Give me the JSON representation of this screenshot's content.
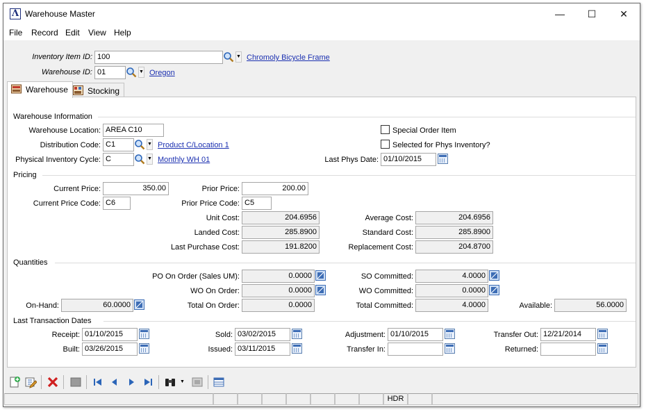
{
  "window": {
    "title": "Warehouse Master",
    "minimize": "—",
    "maximize": "☐",
    "close": "✕"
  },
  "menu": [
    "File",
    "Record",
    "Edit",
    "View",
    "Help"
  ],
  "header": {
    "item_label": "Inventory Item ID:",
    "item_value": "100",
    "item_link": "Chromoly Bicycle Frame",
    "warehouse_label": "Warehouse ID:",
    "warehouse_value": "01",
    "warehouse_link": "Oregon"
  },
  "tabs": [
    {
      "label": "Warehouse",
      "active": true
    },
    {
      "label": "Stocking",
      "active": false
    }
  ],
  "warehouse_info": {
    "section": "Warehouse Information",
    "location_label": "Warehouse Location:",
    "location_value": "AREA C10",
    "dist_label": "Distribution Code:",
    "dist_value": "C1",
    "dist_link": "Product C/Location 1",
    "cycle_label": "Physical Inventory Cycle:",
    "cycle_value": "C",
    "cycle_link": "Monthly WH 01",
    "special_label": "Special Order Item",
    "special_checked": false,
    "selected_label": "Selected for Phys Inventory?",
    "selected_checked": false,
    "lastphys_label": "Last Phys Date:",
    "lastphys_value": "01/10/2015"
  },
  "pricing": {
    "section": "Pricing",
    "current_price_label": "Current Price:",
    "current_price": "350.00",
    "prior_price_label": "Prior Price:",
    "prior_price": "200.00",
    "current_code_label": "Current Price Code:",
    "current_code": "C6",
    "prior_code_label": "Prior Price Code:",
    "prior_code": "C5",
    "unit_cost_label": "Unit Cost:",
    "unit_cost": "204.6956",
    "avg_cost_label": "Average Cost:",
    "avg_cost": "204.6956",
    "landed_label": "Landed Cost:",
    "landed": "285.8900",
    "std_label": "Standard Cost:",
    "std": "285.8900",
    "last_purch_label": "Last Purchase Cost:",
    "last_purch": "191.8200",
    "repl_label": "Replacement Cost:",
    "repl": "204.8700"
  },
  "quantities": {
    "section": "Quantities",
    "po_label": "PO On Order (Sales UM):",
    "po": "0.0000",
    "so_label": "SO Committed:",
    "so": "4.0000",
    "wo_order_label": "WO On Order:",
    "wo_order": "0.0000",
    "wo_comm_label": "WO Committed:",
    "wo_comm": "0.0000",
    "onhand_label": "On-Hand:",
    "onhand": "60.0000",
    "total_order_label": "Total On Order:",
    "total_order": "0.0000",
    "total_comm_label": "Total Committed:",
    "total_comm": "4.0000",
    "avail_label": "Available:",
    "avail": "56.0000"
  },
  "dates": {
    "section": "Last Transaction Dates",
    "receipt_label": "Receipt:",
    "receipt": "01/10/2015",
    "sold_label": "Sold:",
    "sold": "03/02/2015",
    "adj_label": "Adjustment:",
    "adj": "01/10/2015",
    "tout_label": "Transfer Out:",
    "tout": "12/21/2014",
    "built_label": "Built:",
    "built": "03/26/2015",
    "issued_label": "Issued:",
    "issued": "03/11/2015",
    "tin_label": "Transfer In:",
    "tin": "",
    "returned_label": "Returned:",
    "returned": ""
  },
  "status": {
    "hdr": "HDR"
  },
  "colors": {
    "link": "#1a2fb0",
    "border": "#a6a6a6",
    "background": "#f0f0f0"
  }
}
